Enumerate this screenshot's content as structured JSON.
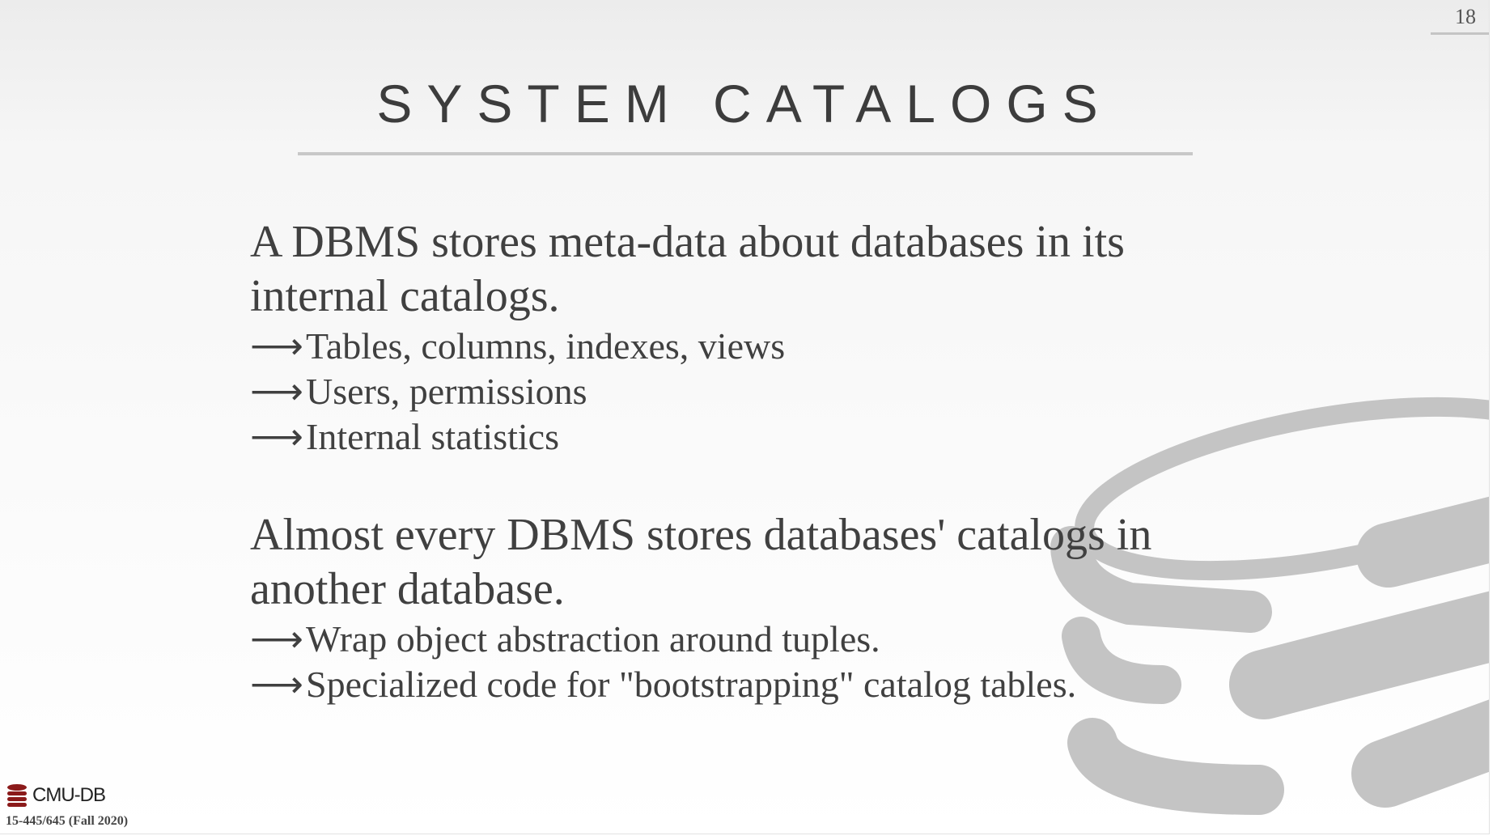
{
  "slide": {
    "page_number": "18",
    "title": "SYSTEM CATALOGS",
    "paragraph1": "A DBMS stores meta-data about databases in its internal catalogs.",
    "bullets1": [
      "Tables, columns, indexes, views",
      "Users, permissions",
      "Internal statistics"
    ],
    "paragraph2": "Almost every DBMS stores databases' catalogs in another database.",
    "bullets2": [
      "Wrap object abstraction around tuples.",
      "Specialized code for \"bootstrapping\" catalog tables."
    ],
    "bullet_arrow": "⟶"
  },
  "footer": {
    "logo_text": "CMU-DB",
    "course": "15-445/645 (Fall 2020)"
  },
  "icons": {
    "watermark": "database-icon",
    "logo": "database-icon"
  },
  "colors": {
    "text": "#404040",
    "watermark": "#c4c4c4",
    "logo": "#8b1a1a"
  }
}
